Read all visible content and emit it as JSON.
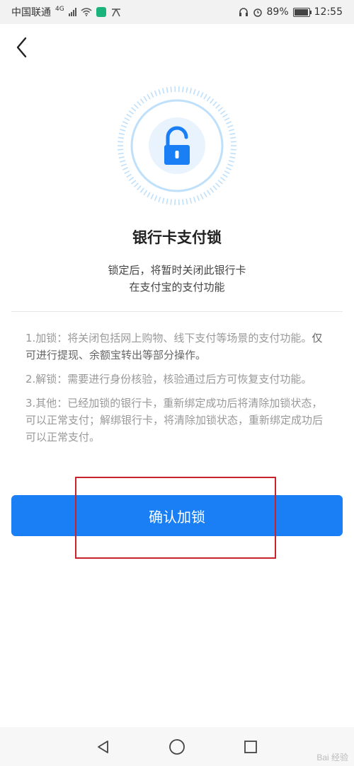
{
  "status_bar": {
    "carrier": "中国联通",
    "network": "4G",
    "battery": "89%",
    "time": "12:55"
  },
  "page": {
    "title": "银行卡支付锁",
    "subtitle_line1": "锁定后，将暂时关闭此银行卡",
    "subtitle_line2": "在支付宝的支付功能",
    "rules": [
      {
        "prefix": "1.加锁：将关闭包括网上购物、线下支付等场景的支付功能。",
        "emphasis": "仅可进行提现、余额宝转出等部分操作。"
      },
      {
        "prefix": "2.解锁：需要进行身份核验，核验通过后方可恢复支付功能。",
        "emphasis": ""
      },
      {
        "prefix": "3.其他：已经加锁的银行卡，重新绑定成功后将清除加锁状态，可以正常支付；解绑银行卡，将清除加锁状态，重新绑定成功后可以正常支付。",
        "emphasis": ""
      }
    ],
    "confirm_label": "确认加锁"
  },
  "watermark": "Bai 经验",
  "colors": {
    "primary": "#1a7ef5",
    "highlight_box": "#c8232c",
    "lock_ring": "#bfe0fb"
  },
  "icons": {
    "back": "chevron-left-icon",
    "lock": "unlocked-padlock-icon",
    "nav_back": "triangle-back-icon",
    "nav_home": "circle-home-icon",
    "nav_recent": "square-recent-icon"
  }
}
